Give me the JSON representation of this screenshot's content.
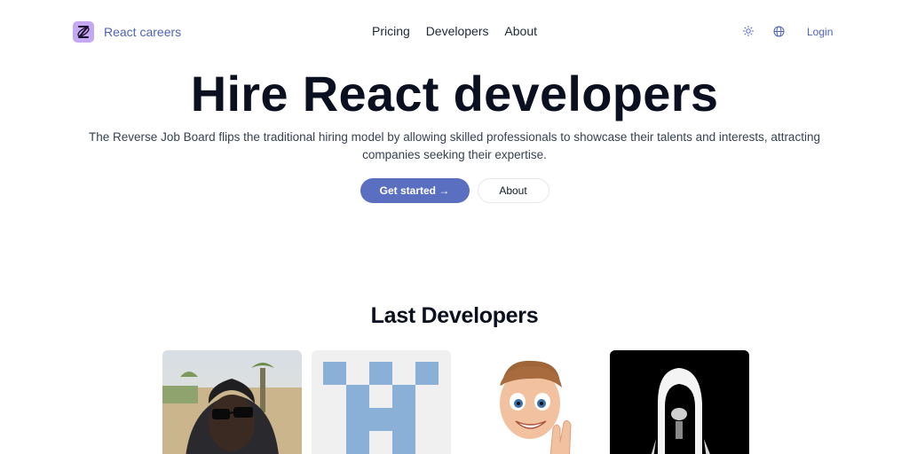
{
  "header": {
    "brand_name": "React careers",
    "nav": [
      "Pricing",
      "Developers",
      "About"
    ],
    "icons": [
      "sun-icon",
      "globe-icon"
    ],
    "login_label": "Login"
  },
  "hero": {
    "title": "Hire React developers",
    "subtitle": "The Reverse Job Board flips the traditional hiring model by allowing skilled professionals to showcase their talents and interests, attracting companies seeking their expertise.",
    "primary_cta": "Get started →",
    "secondary_cta": "About"
  },
  "developers": {
    "title": "Last Developers",
    "cards": [
      {
        "avatar": "photo-portrait-sunglasses"
      },
      {
        "avatar": "pixel-identicon-blue"
      },
      {
        "avatar": "memoji-peace-sign"
      },
      {
        "avatar": "pixel-art-black-white"
      }
    ]
  },
  "colors": {
    "accent": "#5a6fc0",
    "brand_text": "#4f63b8",
    "logo_bg": "#c4a8f0"
  }
}
